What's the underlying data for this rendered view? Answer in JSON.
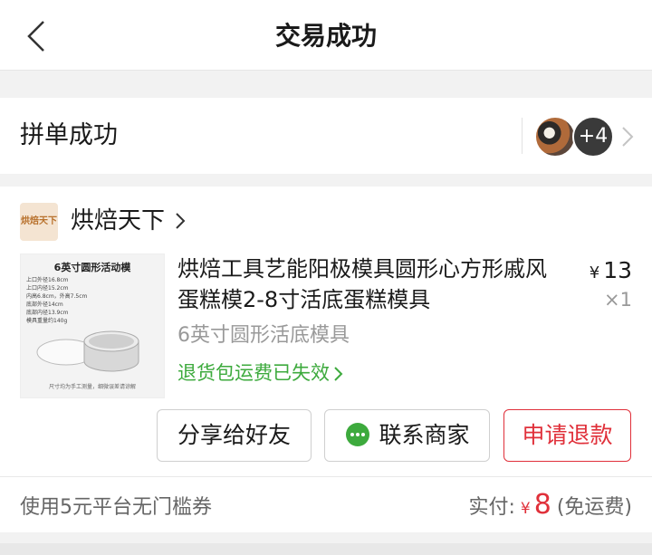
{
  "header": {
    "title": "交易成功",
    "back_icon": "chevron-left-icon"
  },
  "group_buy": {
    "label": "拼单成功",
    "extra_members": "+4"
  },
  "store": {
    "logo_text": "烘焙天下",
    "name": "烘焙天下"
  },
  "product": {
    "name": "烘焙工具艺能阳极模具圆形心方形戚风蛋糕模2-8寸活底蛋糕模具",
    "price_symbol": "¥",
    "price": "13",
    "quantity": "×1",
    "variant": "6英寸圆形活底模具",
    "return_note": "退货包运费已失效",
    "thumbnail": {
      "title": "6英寸圆形活动模",
      "spec": "上口外径16.8cm\n上口内径15.2cm\n内高6.8cm，外高7.5cm\n底部外径14cm\n底部内径13.9cm\n模具重量约140g",
      "note": "尺寸均为手工测量，细微误差请谅解"
    }
  },
  "actions": {
    "share_label": "分享给好友",
    "contact_label": "联系商家",
    "refund_label": "申请退款"
  },
  "summary": {
    "coupon": "使用5元平台无门槛券",
    "paid_label": "实付:",
    "paid_symbol": "¥",
    "paid_amount": "8",
    "shipping": "(免运费)"
  },
  "colors": {
    "accent": "#e0303a",
    "green": "#3daa3d",
    "muted": "#999999"
  }
}
